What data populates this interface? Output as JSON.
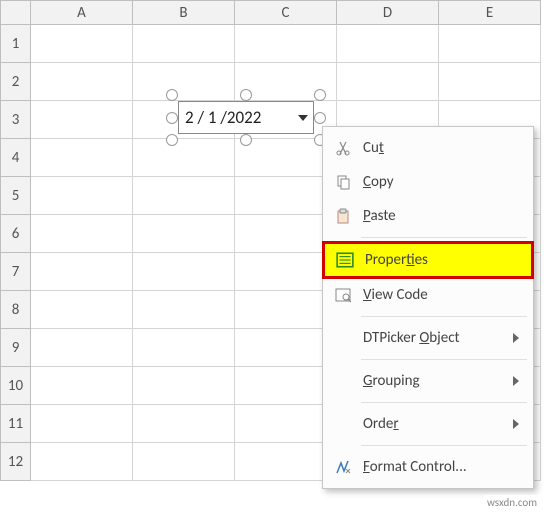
{
  "grid": {
    "columns": [
      "A",
      "B",
      "C",
      "D",
      "E"
    ],
    "rows": [
      "1",
      "2",
      "3",
      "4",
      "5",
      "6",
      "7",
      "8",
      "9",
      "10",
      "11",
      "12"
    ]
  },
  "dtpicker": {
    "value": "2 / 1 /2022"
  },
  "context_menu": {
    "cut": "Cut",
    "copy": "Copy",
    "paste": "Paste",
    "properties": "Properties",
    "view_code": "View Code",
    "dtp_object": "DTPicker Object",
    "grouping": "Grouping",
    "order": "Order",
    "format_control": "Format Control..."
  },
  "watermark": "wsxdn.com"
}
